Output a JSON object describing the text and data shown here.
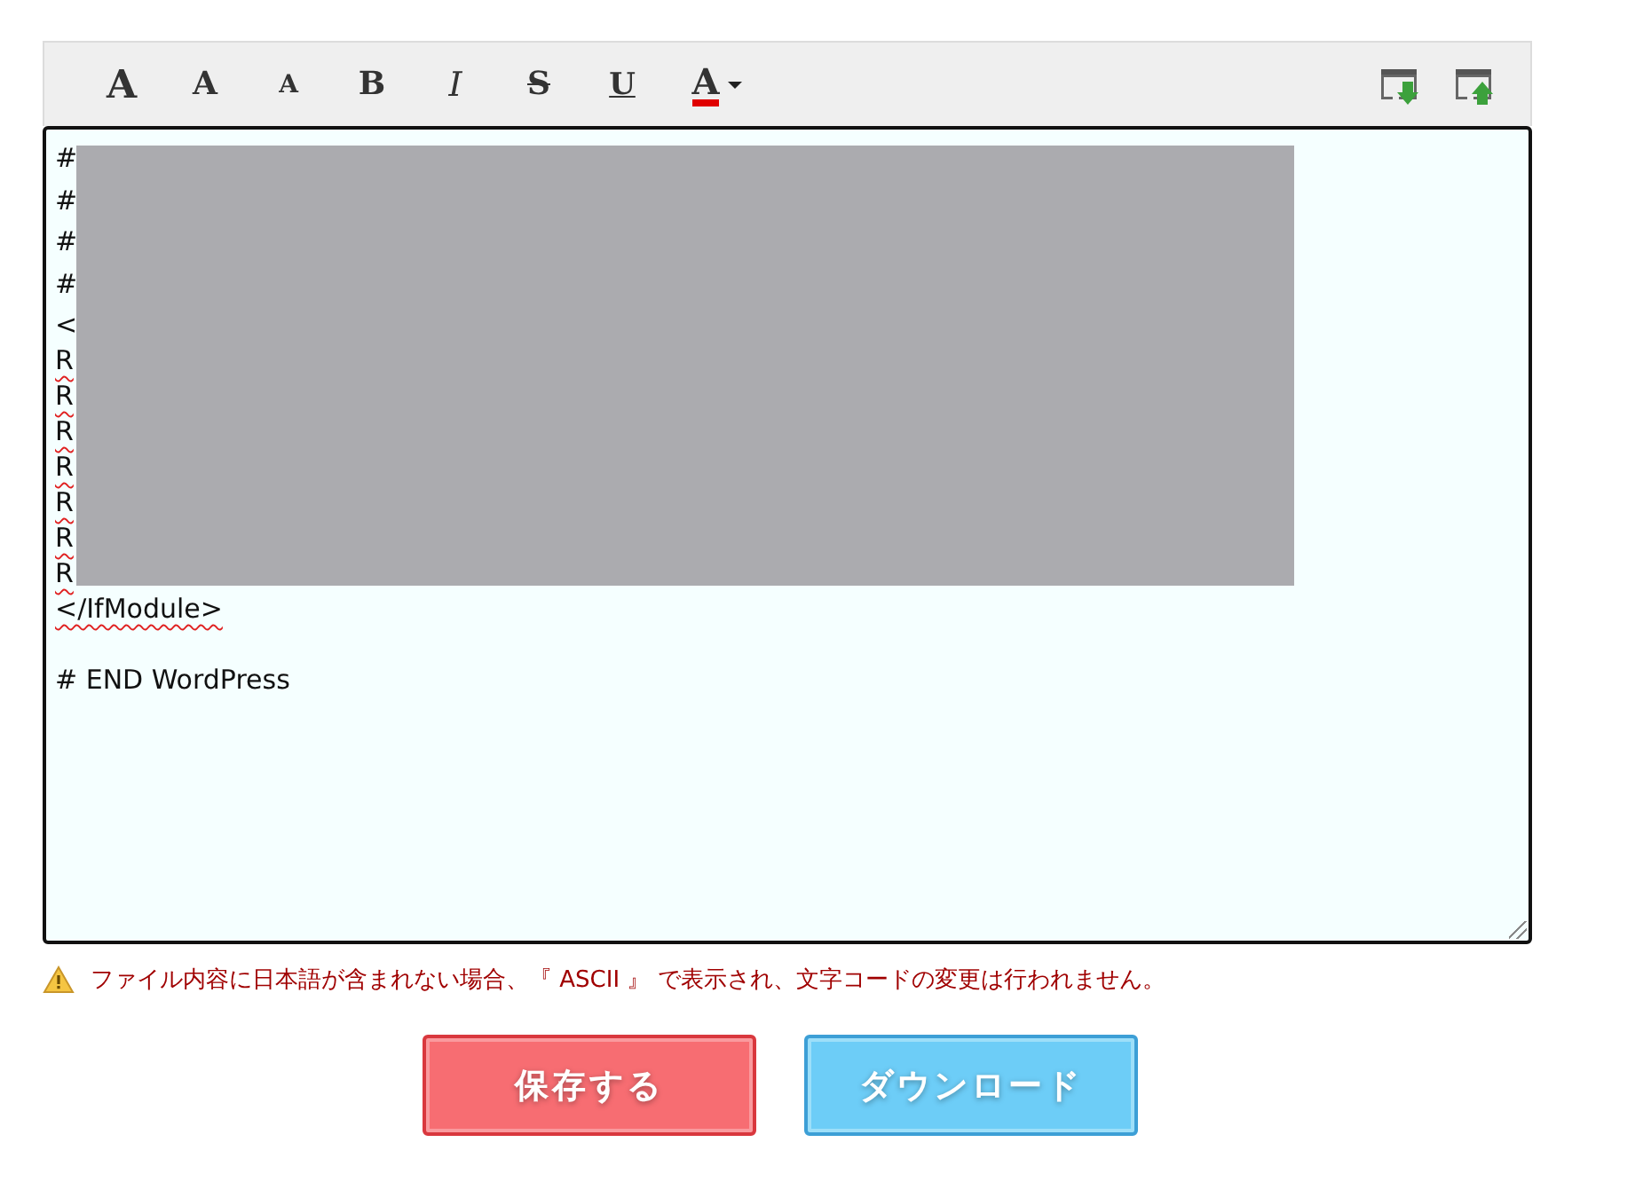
{
  "toolbar": {
    "format_buttons": [
      {
        "kind": "large",
        "label": "A"
      },
      {
        "kind": "medium",
        "label": "A"
      },
      {
        "kind": "small",
        "label": "A"
      },
      {
        "kind": "bold",
        "label": "B"
      },
      {
        "kind": "italic",
        "label": "I"
      },
      {
        "kind": "strike",
        "label": "S"
      },
      {
        "kind": "underline",
        "label": "U"
      },
      {
        "kind": "color",
        "label": "A",
        "color": "#e00000"
      }
    ],
    "file_buttons": [
      {
        "kind": "download"
      },
      {
        "kind": "upload"
      }
    ]
  },
  "editor": {
    "redacted": true,
    "lines": [
      {
        "text": "#",
        "misspelled": false
      },
      {
        "text": "#",
        "misspelled": false
      },
      {
        "text": "#",
        "misspelled": false
      },
      {
        "text": "#",
        "misspelled": false
      },
      {
        "text": "<",
        "misspelled": false
      },
      {
        "text": "R",
        "misspelled": true
      },
      {
        "text": "R",
        "misspelled": true
      },
      {
        "text": "R",
        "misspelled": true
      },
      {
        "text": "R",
        "misspelled": true
      },
      {
        "text": "R",
        "misspelled": true
      },
      {
        "text": "R",
        "misspelled": true
      },
      {
        "text": "R",
        "misspelled": true
      },
      {
        "text": "</IfModule>",
        "misspelled": true
      },
      {
        "text": "# END WordPress",
        "misspelled": false,
        "blank_before": true
      }
    ]
  },
  "notice": "ファイル内容に日本語が含まれない場合、『 ASCII 』 で表示され、文字コードの変更は行われません。",
  "buttons": [
    {
      "kind": "save",
      "label": "保存する"
    },
    {
      "kind": "download",
      "label": "ダウンロード"
    }
  ]
}
